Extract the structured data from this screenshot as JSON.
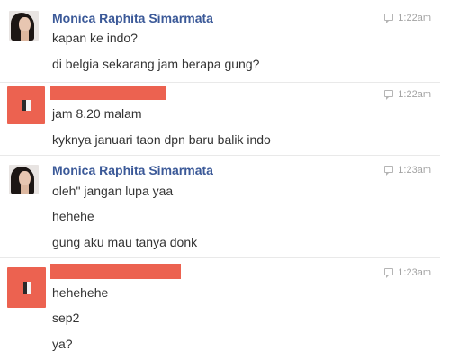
{
  "messages": [
    {
      "author": "Monica Raphita Simarmata",
      "time": "1:22am",
      "lines": [
        "kapan ke indo?",
        "di belgia sekarang jam berapa gung?"
      ]
    },
    {
      "author": "",
      "time": "1:22am",
      "lines": [
        "jam 8.20 malam",
        "kyknya januari taon dpn baru balik indo"
      ]
    },
    {
      "author": "Monica Raphita Simarmata",
      "time": "1:23am",
      "lines": [
        "oleh\" jangan lupa yaa",
        "hehehe",
        "gung aku mau tanya donk"
      ]
    },
    {
      "author": "",
      "time": "1:23am",
      "lines": [
        "hehehehe",
        "sep2",
        "ya?"
      ]
    }
  ],
  "icons": {
    "timestamp": "chat-bubble-icon",
    "avatar_redacted": "redacted-avatar"
  },
  "colors": {
    "author_name": "#3b5998",
    "redaction": "#ec6250",
    "timestamp": "#a3a3a3",
    "text": "#333333"
  }
}
